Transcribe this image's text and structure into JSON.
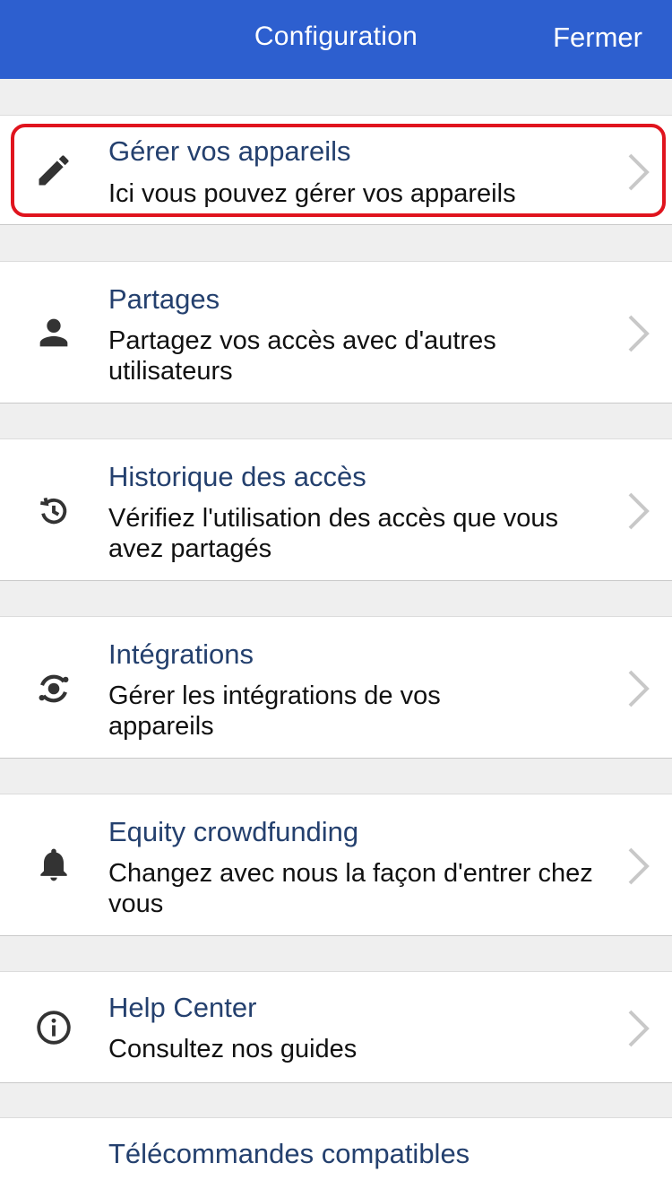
{
  "header": {
    "title": "Configuration",
    "close_label": "Fermer",
    "background": "#2d5fcf"
  },
  "menu": {
    "items": [
      {
        "icon": "pencil-icon",
        "title": "Gérer vos appareils",
        "description": "Ici vous pouvez gérer vos appareils",
        "highlighted": true
      },
      {
        "icon": "person-icon",
        "title": "Partages",
        "description": "Partagez vos accès avec d'autres utilisateurs"
      },
      {
        "icon": "history-icon",
        "title": "Historique des accès",
        "description": "Vérifiez l'utilisation des accès que vous avez partagés"
      },
      {
        "icon": "integrations-icon",
        "title": "Intégrations",
        "description": "Gérer les intégrations de vos appareils"
      },
      {
        "icon": "bell-icon",
        "title": "Equity crowdfunding",
        "description": "Changez avec nous la façon d'entrer chez vous"
      },
      {
        "icon": "info-icon",
        "title": "Help Center",
        "description": "Consultez nos guides"
      },
      {
        "icon": "",
        "title": "Télécommandes compatibles",
        "description": ""
      }
    ]
  },
  "colors": {
    "title_text": "#24406e",
    "highlight_border": "#e0141e",
    "page_background": "#efefef"
  }
}
